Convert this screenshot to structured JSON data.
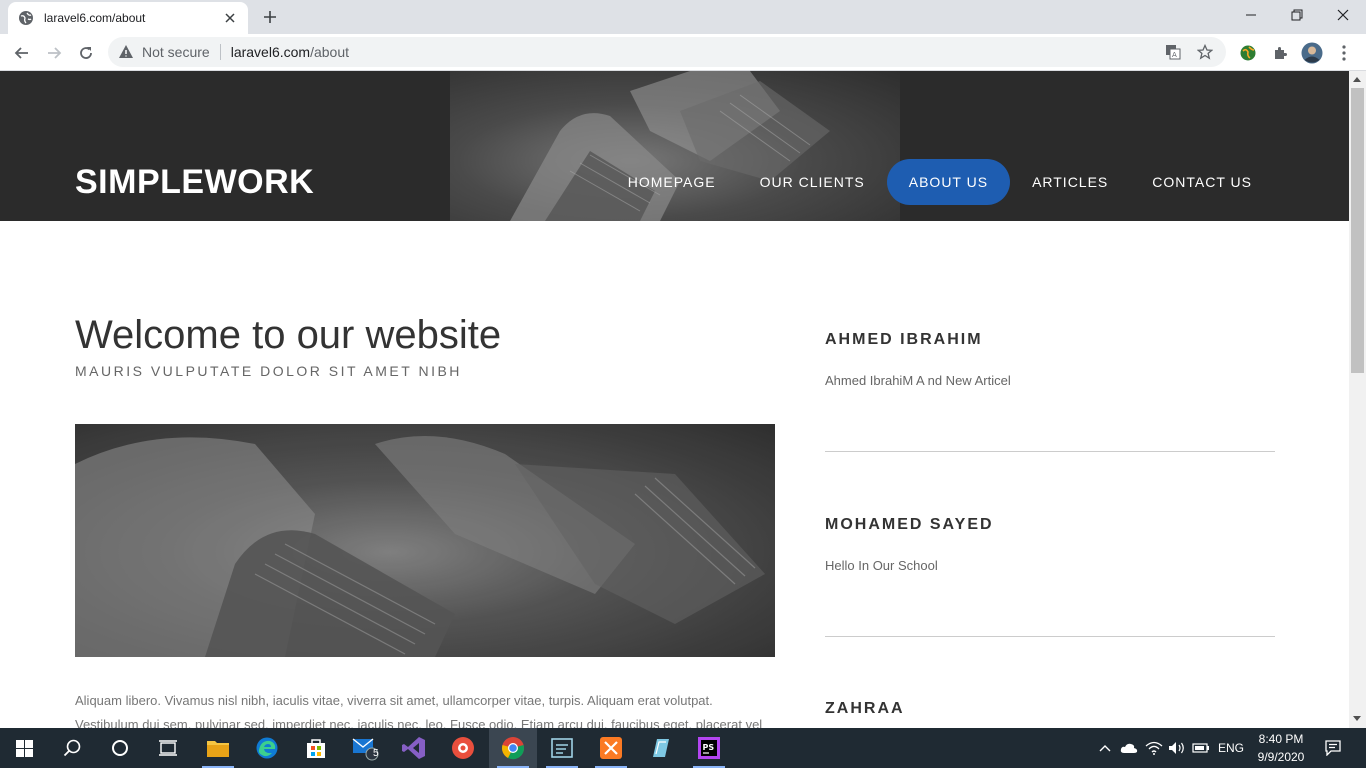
{
  "browser": {
    "tab_title": "laravel6.com/about",
    "security_label": "Not secure",
    "url_host": "laravel6.com",
    "url_path": "/about"
  },
  "site": {
    "logo": "SIMPLEWORK",
    "nav": [
      {
        "label": "HOMEPAGE",
        "active": false
      },
      {
        "label": "OUR CLIENTS",
        "active": false
      },
      {
        "label": "ABOUT US",
        "active": true
      },
      {
        "label": "ARTICLES",
        "active": false
      },
      {
        "label": "CONTACT US",
        "active": false
      }
    ],
    "accent_color": "#1e5db1",
    "header_bg": "#2b2b2b"
  },
  "main": {
    "title": "Welcome to our website",
    "subtitle": "MAURIS VULPUTATE DOLOR SIT AMET NIBH",
    "body_line1": "Aliquam libero. Vivamus nisl nibh, iaculis vitae, viverra sit amet, ullamcorper vitae, turpis. Aliquam erat volutpat.",
    "body_line2": "Vestibulum dui sem, pulvinar sed, imperdiet nec, iaculis nec, leo. Fusce odio. Etiam arcu dui, faucibus eget, placerat vel"
  },
  "sidebar": {
    "items": [
      {
        "title": "AHMED IBRAHIM",
        "text": "Ahmed IbrahiM A nd New Articel"
      },
      {
        "title": "MOHAMED SAYED",
        "text": "Hello In Our School"
      },
      {
        "title": "ZAHRAA",
        "text": ""
      }
    ]
  },
  "taskbar": {
    "mail_badge": "5",
    "language": "ENG",
    "time": "8:40 PM",
    "date": "9/9/2020"
  }
}
